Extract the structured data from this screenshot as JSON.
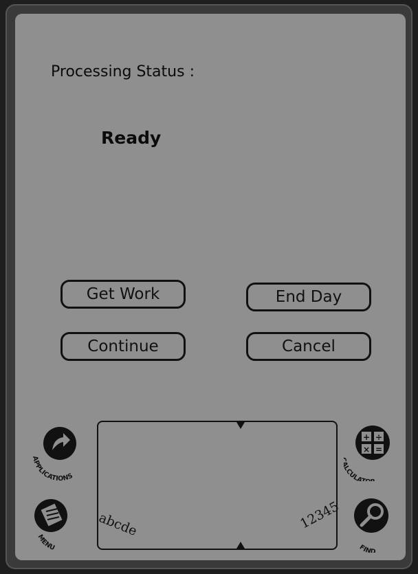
{
  "status": {
    "label": "Processing Status :",
    "value": "Ready"
  },
  "buttons": {
    "get_work": "Get Work",
    "end_day": "End Day",
    "continue": "Continue",
    "cancel": "Cancel"
  },
  "graffiti": {
    "alpha_hint": "abcde",
    "numeric_hint": "12345"
  },
  "silkscreen": {
    "applications": "APPLICATIONS",
    "menu": "MENU",
    "calculator": "CALCULATOR",
    "find": "FIND"
  },
  "colors": {
    "screen_bg": "#8f8f8f",
    "frame": "#3a3a3a",
    "ink": "#111111"
  }
}
